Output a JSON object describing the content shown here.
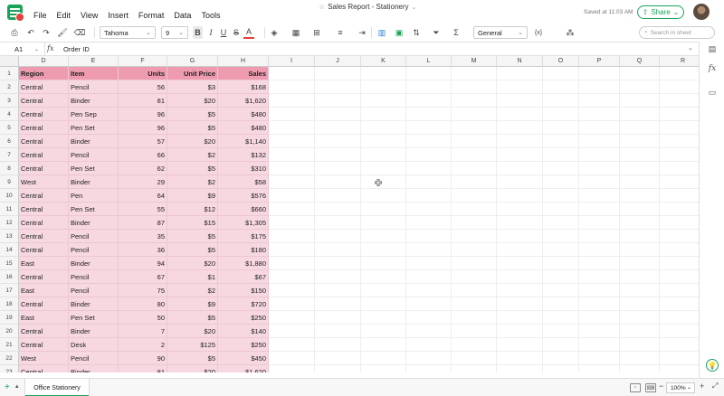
{
  "menu": [
    "File",
    "Edit",
    "View",
    "Insert",
    "Format",
    "Data",
    "Tools"
  ],
  "title": "Sales Report - Stationery",
  "saved_status": "Saved at 11:03 AM",
  "share_label": "Share",
  "toolbar": {
    "font_name": "Tahoma",
    "font_size": "9",
    "number_format": "General",
    "search_placeholder": "Search in sheet",
    "bold": "B",
    "italic": "I",
    "underline": "U",
    "strike": "S",
    "font_color": "A",
    "func_label": "{x}"
  },
  "formula_bar": {
    "cell_ref": "A1",
    "fx": "fx",
    "value": "Order ID"
  },
  "columns": [
    "D",
    "E",
    "F",
    "G",
    "H",
    "I",
    "J",
    "K",
    "L",
    "M",
    "N",
    "O",
    "P",
    "Q",
    "R"
  ],
  "header_row": {
    "row_number": "1",
    "cells": [
      "Region",
      "Item",
      "Units",
      "Unit Price",
      "Sales"
    ]
  },
  "rows": [
    {
      "n": "2",
      "cells": [
        "Central",
        "Pencil",
        "56",
        "$3",
        "$168"
      ]
    },
    {
      "n": "3",
      "cells": [
        "Central",
        "Binder",
        "81",
        "$20",
        "$1,620"
      ]
    },
    {
      "n": "4",
      "cells": [
        "Central",
        "Pen Sep",
        "96",
        "$5",
        "$480"
      ]
    },
    {
      "n": "5",
      "cells": [
        "Central",
        "Pen Set",
        "96",
        "$5",
        "$480"
      ]
    },
    {
      "n": "6",
      "cells": [
        "Central",
        "Binder",
        "57",
        "$20",
        "$1,140"
      ]
    },
    {
      "n": "7",
      "cells": [
        "Central",
        "Pencil",
        "66",
        "$2",
        "$132"
      ]
    },
    {
      "n": "8",
      "cells": [
        "Central",
        "Pen Set",
        "62",
        "$5",
        "$310"
      ]
    },
    {
      "n": "9",
      "cells": [
        "West",
        "Binder",
        "29",
        "$2",
        "$58"
      ]
    },
    {
      "n": "10",
      "cells": [
        "Central",
        "Pen",
        "64",
        "$9",
        "$576"
      ]
    },
    {
      "n": "11",
      "cells": [
        "Central",
        "Pen Set",
        "55",
        "$12",
        "$660"
      ]
    },
    {
      "n": "12",
      "cells": [
        "Central",
        "Binder",
        "87",
        "$15",
        "$1,305"
      ]
    },
    {
      "n": "13",
      "cells": [
        "Central",
        "Pencil",
        "35",
        "$5",
        "$175"
      ]
    },
    {
      "n": "14",
      "cells": [
        "Central",
        "Pencil",
        "36",
        "$5",
        "$180"
      ]
    },
    {
      "n": "15",
      "cells": [
        "East",
        "Binder",
        "94",
        "$20",
        "$1,880"
      ]
    },
    {
      "n": "16",
      "cells": [
        "Central",
        "Pencil",
        "67",
        "$1",
        "$67"
      ]
    },
    {
      "n": "17",
      "cells": [
        "East",
        "Pencil",
        "75",
        "$2",
        "$150"
      ]
    },
    {
      "n": "18",
      "cells": [
        "Central",
        "Binder",
        "80",
        "$9",
        "$720"
      ]
    },
    {
      "n": "19",
      "cells": [
        "East",
        "Pen Set",
        "50",
        "$5",
        "$250"
      ]
    },
    {
      "n": "20",
      "cells": [
        "Central",
        "Binder",
        "7",
        "$20",
        "$140"
      ]
    },
    {
      "n": "21",
      "cells": [
        "Central",
        "Desk",
        "2",
        "$125",
        "$250"
      ]
    },
    {
      "n": "22",
      "cells": [
        "West",
        "Pencil",
        "90",
        "$5",
        "$450"
      ]
    },
    {
      "n": "23",
      "cells": [
        "Central",
        "Binder",
        "81",
        "$20",
        "$1,620"
      ]
    }
  ],
  "sheet_tab": "Office Stationery",
  "zoom": "100%",
  "colors": {
    "brand": "#1aa35a",
    "header_fill": "#ee9bb0",
    "data_fill": "#f7d8e1"
  }
}
